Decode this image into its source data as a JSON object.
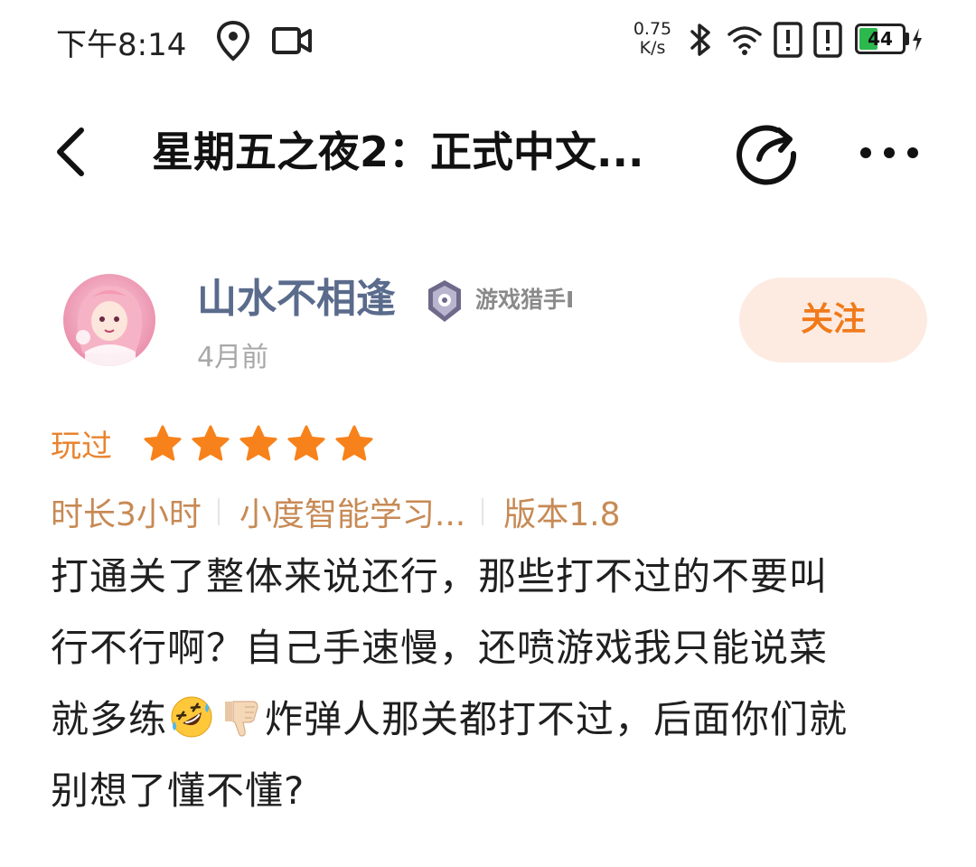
{
  "status_bar": {
    "time": "下午8:14",
    "net_speed_value": "0.75",
    "net_speed_unit": "K/s",
    "battery_level": "44",
    "battery_fraction": 0.44,
    "icons": [
      "location-icon",
      "video-record-icon",
      "bluetooth-icon",
      "wifi-icon",
      "alert-icon",
      "alert-icon",
      "battery-icon",
      "charging-icon"
    ]
  },
  "header": {
    "title": "星期五之夜2：正式中文...",
    "back_icon": "chevron-left-icon",
    "share_icon": "share-icon",
    "more_icon": "more-dots-icon"
  },
  "author": {
    "name": "山水不相逢",
    "badge": "游戏猎手I",
    "time_ago": "4月前",
    "follow_label": "关注"
  },
  "rating": {
    "played_label": "玩过",
    "stars": 5,
    "max_stars": 5,
    "star_color": "#f7821b"
  },
  "meta": {
    "duration": "时长3小时",
    "device": "小度智能学习...",
    "version": "版本1.8"
  },
  "review": {
    "line1": "打通关了整体来说还行，那些打不过的不要叫",
    "line2": "行不行啊？自己手速慢，还喷游戏我只能说菜",
    "line3_a": "就多练",
    "line3_b": "炸弹人那关都打不过，后面你们就",
    "line4": "别想了懂不懂?",
    "emojis": [
      "rolling-laughing-emoji",
      "thumbs-down-emoji"
    ]
  },
  "colors": {
    "accent": "#f07a1a",
    "author_name": "#5a6b8c",
    "meta_text": "#c78a55",
    "follow_bg": "#fdebe2"
  }
}
